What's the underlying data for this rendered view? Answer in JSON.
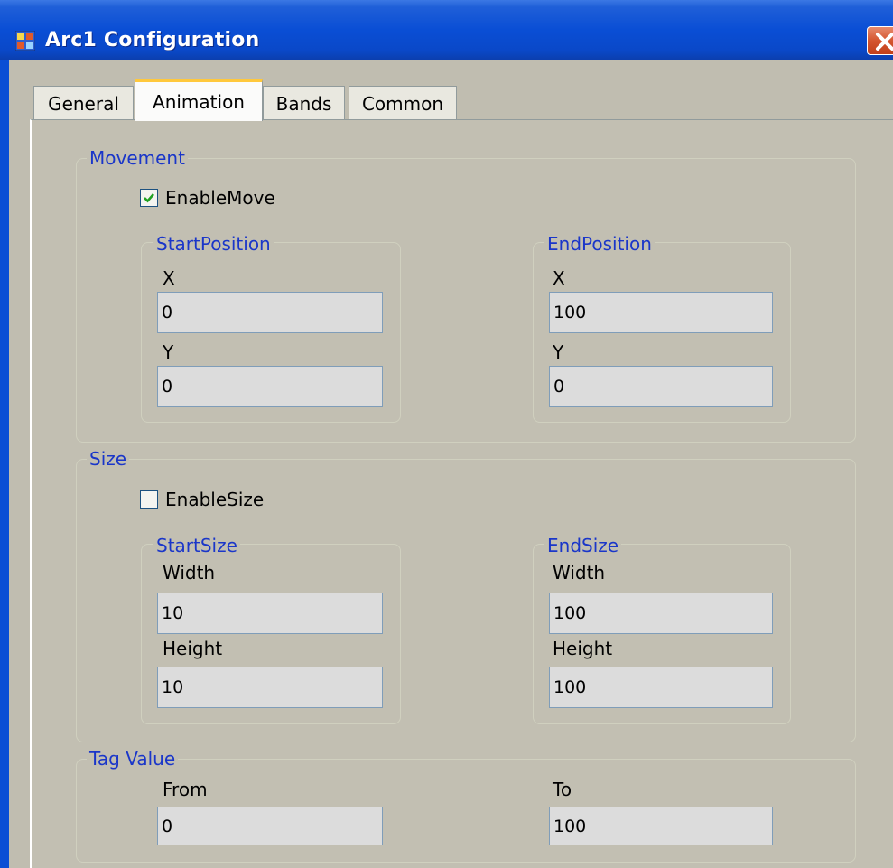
{
  "window": {
    "title": "Arc1 Configuration"
  },
  "tabs": [
    "General",
    "Animation",
    "Bands",
    "Common"
  ],
  "movement": {
    "title": "Movement",
    "enable_label": "EnableMove",
    "enabled": true,
    "start": {
      "title": "StartPosition",
      "x_label": "X",
      "x": "0",
      "y_label": "Y",
      "y": "0"
    },
    "end": {
      "title": "EndPosition",
      "x_label": "X",
      "x": "100",
      "y_label": "Y",
      "y": "0"
    }
  },
  "size": {
    "title": "Size",
    "enable_label": "EnableSize",
    "enabled": false,
    "start": {
      "title": "StartSize",
      "width_label": "Width",
      "width": "10",
      "height_label": "Height",
      "height": "10"
    },
    "end": {
      "title": "EndSize",
      "width_label": "Width",
      "width": "100",
      "height_label": "Height",
      "height": "100"
    }
  },
  "tag_value": {
    "title": "Tag Value",
    "from_label": "From",
    "from": "0",
    "to_label": "To",
    "to": "100"
  },
  "colors": {
    "title_bar": "#0a4ed5",
    "group_title": "#1a36c9",
    "close_button": "#d4552f",
    "active_tab_accent": "#ffc83c"
  }
}
